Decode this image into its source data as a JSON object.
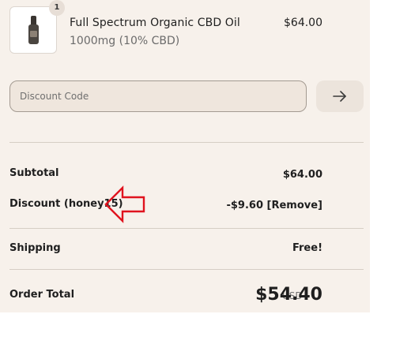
{
  "product": {
    "quantity": "1",
    "name": "Full Spectrum Organic CBD Oil",
    "variant": "1000mg (10% CBD)",
    "price": "$64.00",
    "image_icon": "cbd-oil-bottle-icon"
  },
  "discount": {
    "placeholder": "Discount Code",
    "apply_icon": "arrow-right-icon"
  },
  "summary": {
    "subtotal_label": "Subtotal",
    "subtotal_value": "$64.00",
    "discount_label": "Discount (honey15)",
    "discount_value": "-$9.60 [Remove]",
    "shipping_label": "Shipping",
    "shipping_value": "Free!",
    "total_label": "Order Total",
    "total_currency": "USD",
    "total_value": "$54.40"
  },
  "annotation": {
    "icon": "red-arrow-pointing-left-icon",
    "color": "#e0131e"
  },
  "colors": {
    "panel_bg": "#f7f1eb",
    "input_bg": "#efe6dd",
    "divider": "#d6cec5"
  }
}
